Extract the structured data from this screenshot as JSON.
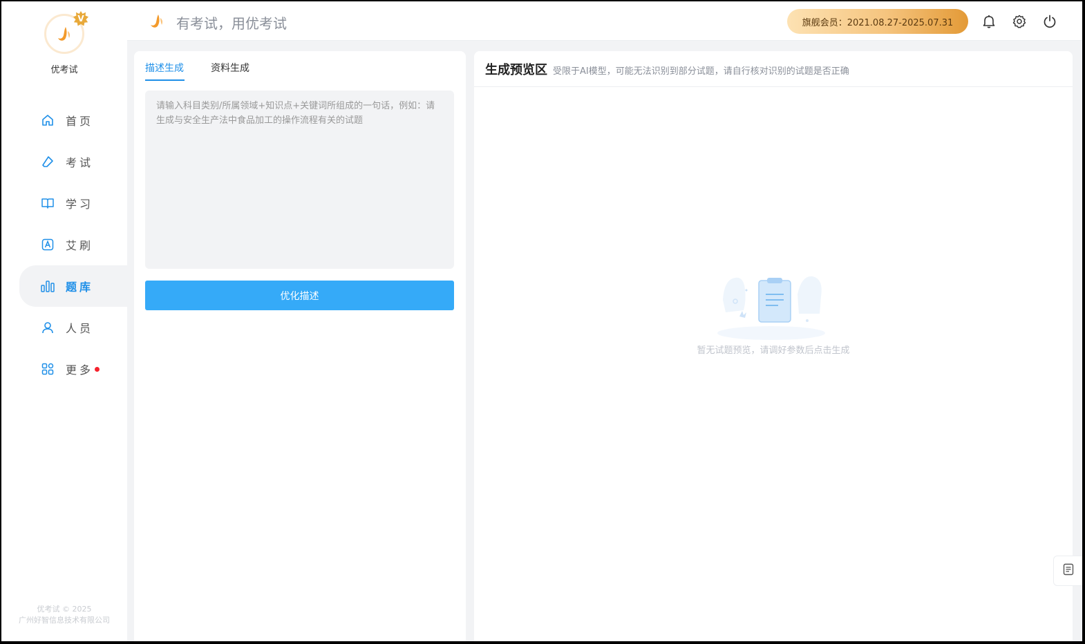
{
  "app": {
    "brand_name": "优考试",
    "vip_mark": "V",
    "slogan": "有考试，用优考试",
    "copyright_line1": "优考试 © 2025",
    "copyright_line2": "广州好智信息技术有限公司"
  },
  "sidebar": {
    "items": [
      {
        "label": "首页",
        "icon": "home-icon"
      },
      {
        "label": "考试",
        "icon": "eraser-icon"
      },
      {
        "label": "学习",
        "icon": "book-icon"
      },
      {
        "label": "艾刷",
        "icon": "a-box-icon"
      },
      {
        "label": "题库",
        "icon": "bar-chart-icon",
        "active": true
      },
      {
        "label": "人员",
        "icon": "user-icon"
      },
      {
        "label": "更多",
        "icon": "grid-icon",
        "has_badge": true
      }
    ]
  },
  "header": {
    "member_badge": "旗舰会员：2021.08.27-2025.07.31"
  },
  "left_panel": {
    "tabs": [
      {
        "label": "描述生成",
        "active": true
      },
      {
        "label": "资料生成",
        "active": false
      }
    ],
    "description_placeholder": "请输入科目类别/所属领域+知识点+关键词所组成的一句话，例如：请生成与安全生产法中食品加工的操作流程有关的试题",
    "description_value": "",
    "optimize_button": "优化描述"
  },
  "right_panel": {
    "title": "生成预览区",
    "note": "受限于AI模型，可能无法识别到部分试题，请自行核对识别的试题是否正确",
    "empty_text": "暂无试题预览，请调好参数后点击生成"
  },
  "colors": {
    "accent": "#1e8fe8",
    "button": "#35aaf8",
    "badge_gold": "#e39a37",
    "dot_red": "#f5222d"
  }
}
